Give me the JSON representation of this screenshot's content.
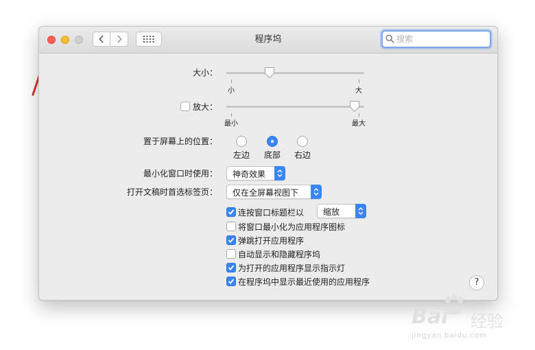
{
  "window": {
    "title": "程序坞",
    "search": {
      "placeholder": "搜索",
      "value": ""
    }
  },
  "size": {
    "label": "大小：",
    "min_label": "小",
    "max_label": "大",
    "level": 0.3
  },
  "magnification": {
    "label": "放大：",
    "checked": false,
    "min_label": "最小",
    "max_label": "最大",
    "level": 0.97
  },
  "position": {
    "label": "置于屏幕上的位置：",
    "options": [
      "左边",
      "底部",
      "右边"
    ],
    "selected": "底部"
  },
  "minimize_effect": {
    "label": "最小化窗口时使用：",
    "value": "神奇效果"
  },
  "prefer_tabs": {
    "label": "打开文稿时首选标签页：",
    "value": "仅在全屏幕视图下"
  },
  "options": [
    {
      "label": "连按窗口标题栏以",
      "checked": true,
      "popup": "缩放"
    },
    {
      "label": "将窗口最小化为应用程序图标",
      "checked": false
    },
    {
      "label": "弹跳打开应用程序",
      "checked": true
    },
    {
      "label": "自动显示和隐藏程序坞",
      "checked": false
    },
    {
      "label": "为打开的应用程序显示指示灯",
      "checked": true
    },
    {
      "label": "在程序坞中显示最近使用的应用程序",
      "checked": true
    }
  ],
  "help_label": "?",
  "watermark": {
    "brand": "Bai",
    "brand2": "经验",
    "url": "jingyan.baidu.com"
  },
  "colors": {
    "accent": "#3a86f7",
    "annotation_arrow": "#e0302a",
    "close": "#fc5f57",
    "minimize": "#fdbc2e"
  }
}
